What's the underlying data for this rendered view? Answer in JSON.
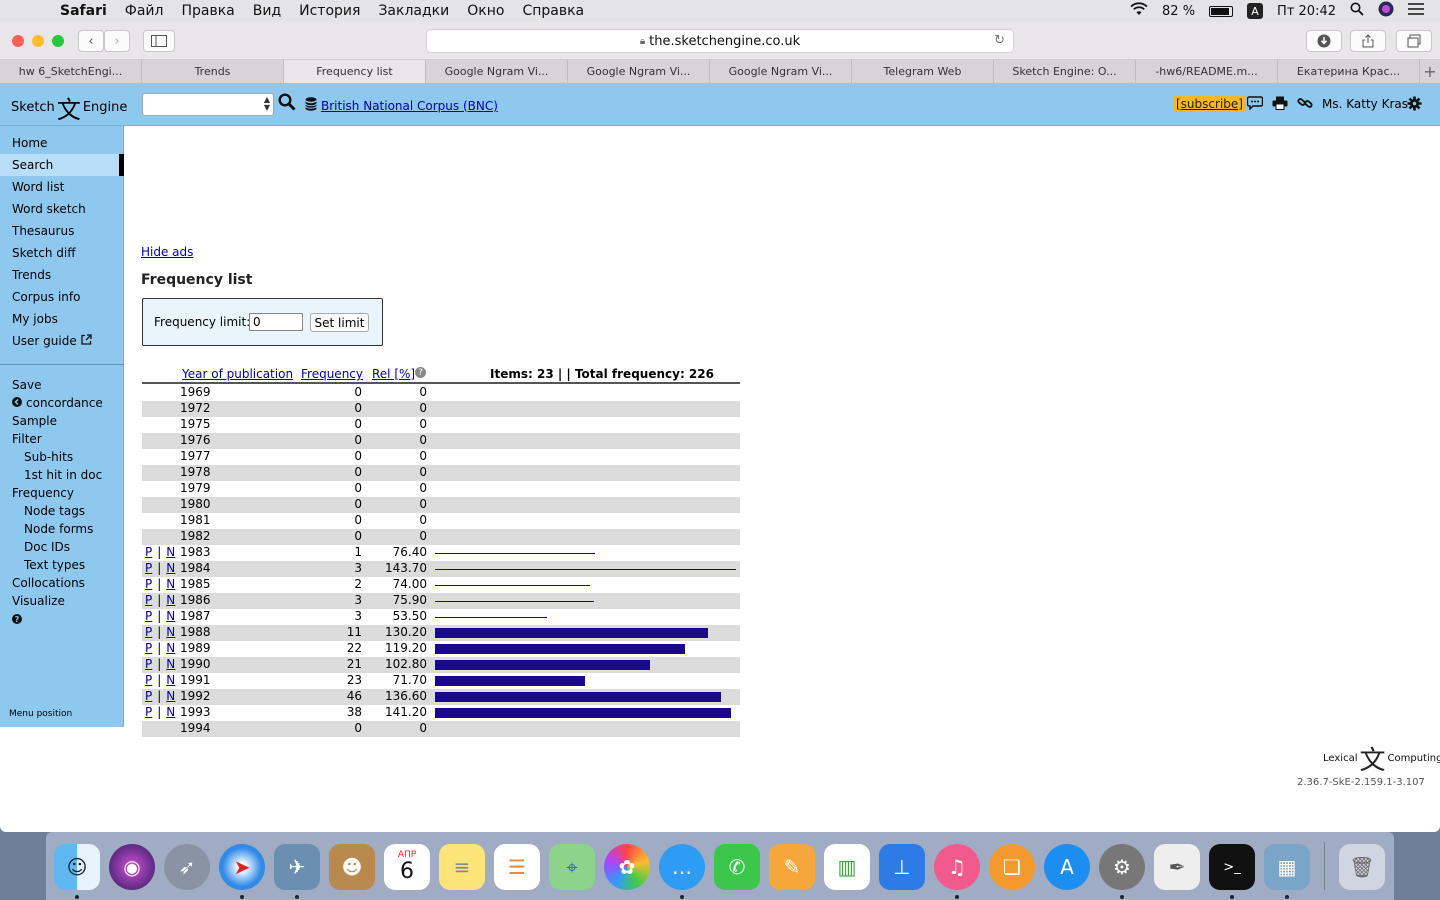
{
  "menubar": {
    "app_name": "Safari",
    "items": [
      "Файл",
      "Правка",
      "Вид",
      "История",
      "Закладки",
      "Окно",
      "Справка"
    ],
    "battery": "82 %",
    "input_source": "A",
    "clock": "Пт 20:42"
  },
  "browser": {
    "url": "the.sketchengine.co.uk",
    "tabs": [
      {
        "label": "hw 6_SketchEngi..."
      },
      {
        "label": "Trends"
      },
      {
        "label": "Frequency list"
      },
      {
        "label": "Google Ngram Vi..."
      },
      {
        "label": "Google Ngram Vi..."
      },
      {
        "label": "Google Ngram Vi..."
      },
      {
        "label": "Telegram Web"
      },
      {
        "label": "Sketch Engine: O..."
      },
      {
        "label": "-hw6/README.m..."
      },
      {
        "label": "Екатерина Крас..."
      }
    ],
    "active_tab": 2
  },
  "header": {
    "logo_left": "Sketch",
    "logo_right": "Engine",
    "corpus": "British National Corpus (BNC)",
    "subscribe": "[subscribe]",
    "user": "Ms. Katty Kras"
  },
  "sidebar": {
    "main": [
      "Home",
      "Search",
      "Word list",
      "Word sketch",
      "Thesaurus",
      "Sketch diff",
      "Trends",
      "Corpus info",
      "My jobs",
      "User guide"
    ],
    "tools": {
      "save": "Save",
      "concordance": "concordance",
      "sample": "Sample",
      "filter": "Filter",
      "subhits": "Sub-hits",
      "first_hit": "1st hit in doc",
      "frequency": "Frequency",
      "node_tags": "Node tags",
      "node_forms": "Node forms",
      "doc_ids": "Doc IDs",
      "text_types": "Text types",
      "collocations": "Collocations",
      "visualize": "Visualize"
    },
    "menu_position": "Menu position"
  },
  "content": {
    "hide_ads": "Hide ads",
    "title": "Frequency list",
    "limit_label": "Frequency limit:",
    "limit_value": "0",
    "set_limit": "Set limit",
    "col_year": "Year of publication",
    "col_freq": "Frequency",
    "col_rel": "Rel [%]",
    "summary": "Items: 23 | | Total frequency: 226",
    "p_label": "P",
    "n_label": "N",
    "sep": "|"
  },
  "table": [
    {
      "year": "1969",
      "freq": "0",
      "rel": "0"
    },
    {
      "year": "1972",
      "freq": "0",
      "rel": "0"
    },
    {
      "year": "1975",
      "freq": "0",
      "rel": "0"
    },
    {
      "year": "1976",
      "freq": "0",
      "rel": "0"
    },
    {
      "year": "1977",
      "freq": "0",
      "rel": "0"
    },
    {
      "year": "1978",
      "freq": "0",
      "rel": "0"
    },
    {
      "year": "1979",
      "freq": "0",
      "rel": "0"
    },
    {
      "year": "1980",
      "freq": "0",
      "rel": "0"
    },
    {
      "year": "1981",
      "freq": "0",
      "rel": "0"
    },
    {
      "year": "1982",
      "freq": "0",
      "rel": "0"
    },
    {
      "year": "1983",
      "freq": "1",
      "rel": "76.40",
      "links": true
    },
    {
      "year": "1984",
      "freq": "3",
      "rel": "143.70",
      "links": true
    },
    {
      "year": "1985",
      "freq": "2",
      "rel": "74.00",
      "links": true
    },
    {
      "year": "1986",
      "freq": "3",
      "rel": "75.90",
      "links": true
    },
    {
      "year": "1987",
      "freq": "3",
      "rel": "53.50",
      "links": true
    },
    {
      "year": "1988",
      "freq": "11",
      "rel": "130.20",
      "links": true
    },
    {
      "year": "1989",
      "freq": "22",
      "rel": "119.20",
      "links": true
    },
    {
      "year": "1990",
      "freq": "21",
      "rel": "102.80",
      "links": true
    },
    {
      "year": "1991",
      "freq": "23",
      "rel": "71.70",
      "links": true
    },
    {
      "year": "1992",
      "freq": "46",
      "rel": "136.60",
      "links": true
    },
    {
      "year": "1993",
      "freq": "38",
      "rel": "141.20",
      "links": true
    },
    {
      "year": "1994",
      "freq": "0",
      "rel": "0"
    }
  ],
  "footer": {
    "brand_left": "Lexical",
    "brand_right": "Computing",
    "version": "2.36.7-SkE-2.159.1-3.107"
  },
  "dock": {
    "calendar_month": "АПР",
    "calendar_day": "6",
    "apps": [
      "finder",
      "siri",
      "launchpad",
      "safari",
      "preview-eagle",
      "contacts",
      "calendar",
      "notes",
      "reminders",
      "maps",
      "photos",
      "messages",
      "facetime",
      "pages",
      "numbers",
      "keynote",
      "itunes",
      "ibooks",
      "app-store",
      "system-preferences",
      "textedit",
      "terminal",
      "preview",
      "trash"
    ]
  },
  "colors": {
    "header_bg": "#8ec8ef",
    "bar_color": "#1a0a8a",
    "link_color": "#0000aa",
    "subscribe_bg": "#f6b52b"
  }
}
